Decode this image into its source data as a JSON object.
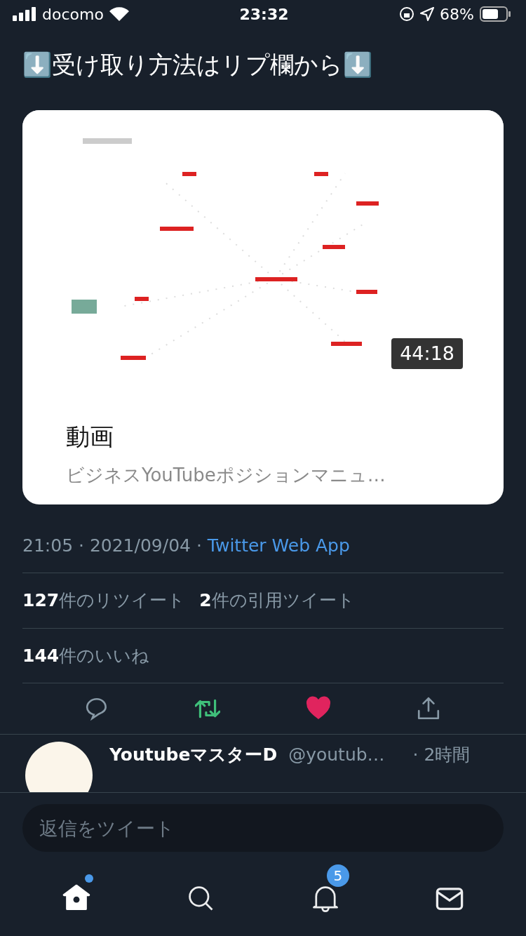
{
  "status_bar": {
    "carrier": "docomo",
    "time": "23:32",
    "battery": "68%"
  },
  "tweet": {
    "text": "⬇️受け取り方法はリプ欄から⬇️",
    "card": {
      "kind": "picture",
      "duration": "44:18",
      "title": "動画",
      "description": "ビジネスYouTubeポジションマニュ…"
    },
    "timestamp": "21:05 · 2021/09/04 ·",
    "source": "Twitter Web App",
    "stats": [
      [
        "**127**件のリツイート",
        "**2**件の引用ツイート"
      ],
      [
        "**144**件のいいね"
      ]
    ],
    "actions": [
      {
        "kind": "reply",
        "on": false
      },
      {
        "kind": "retweet",
        "on": true
      },
      {
        "kind": "like",
        "on": true
      },
      {
        "kind": "share"
      }
    ]
  },
  "reply": {
    "name": "YoutubeマスターD",
    "handle": "@youtub…",
    "time": "· 2時間"
  },
  "composer": {
    "placeholder": "返信をツイート"
  },
  "tabs": [
    {
      "kind": "home",
      "selected": true,
      "dot": true
    },
    {
      "kind": "search",
      "selected": false
    },
    {
      "kind": "notifications",
      "selected": false,
      "badge": "5"
    },
    {
      "kind": "messages",
      "selected": false
    }
  ]
}
